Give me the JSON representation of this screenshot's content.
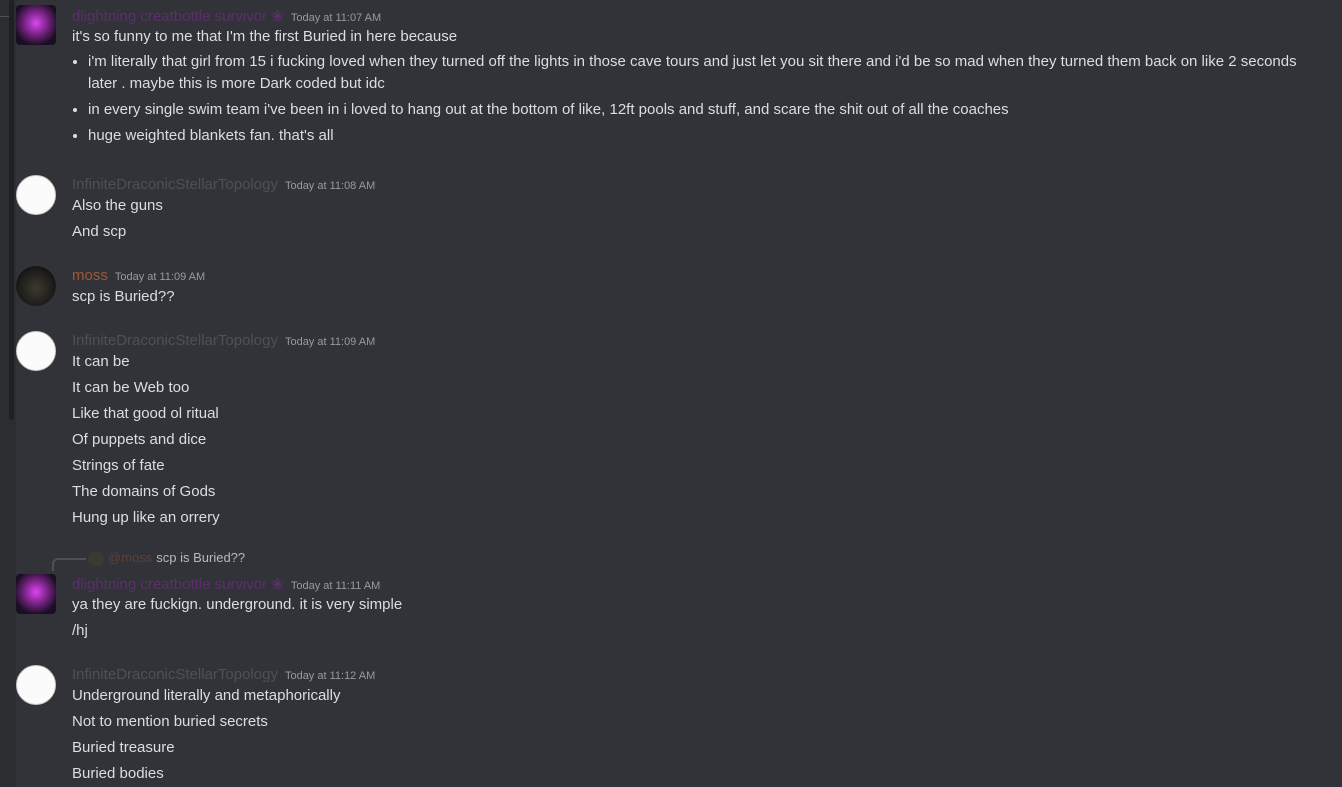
{
  "messages": [
    {
      "username": "dlightning creatbottle survivor ❀",
      "timestamp": "Today at 11:07 AM",
      "lines": [
        "it's so funny to me that I'm the first Buried in here because"
      ],
      "bullets": [
        "i'm literally that girl from 15 i fucking loved when they turned off the lights in those cave tours and just let you sit there and i'd be so mad when they turned them back on like 2 seconds later . maybe this is more Dark coded but idc",
        "in every single swim team i've been in i loved to hang out at the bottom of like, 12ft pools and stuff, and scare the shit out of all the coaches",
        "huge weighted blankets fan. that's all"
      ]
    },
    {
      "username": "InfiniteDraconicStellarTopology",
      "timestamp": "Today at 11:08 AM",
      "lines": [
        "Also the guns",
        "And scp"
      ]
    },
    {
      "username": "moss",
      "timestamp": "Today at 11:09 AM",
      "lines": [
        "scp is Buried??"
      ]
    },
    {
      "username": "InfiniteDraconicStellarTopology",
      "timestamp": "Today at 11:09 AM",
      "lines": [
        "It can be",
        "It can be Web too",
        "Like that good ol ritual",
        "Of puppets and dice",
        "Strings of fate",
        "The domains of Gods",
        "Hung up like an orrery"
      ]
    },
    {
      "reply": {
        "mention": "@moss",
        "snippet": "scp is Buried??"
      },
      "username": "dlightning creatbottle survivor ❀",
      "timestamp": "Today at 11:11 AM",
      "lines": [
        "ya they are fuckign. underground. it is very simple",
        "/hj"
      ]
    },
    {
      "username": "InfiniteDraconicStellarTopology",
      "timestamp": "Today at 11:12 AM",
      "lines": [
        "Underground literally and metaphorically",
        "Not to mention buried secrets",
        "Buried treasure",
        "Buried bodies"
      ]
    }
  ],
  "colors": {
    "background": "#313338",
    "text": "#dbdee1",
    "timestamp": "#949ba4",
    "username_purple": "#5b2f6a",
    "username_gray": "#4e5058",
    "username_moss": "#a0583a"
  }
}
